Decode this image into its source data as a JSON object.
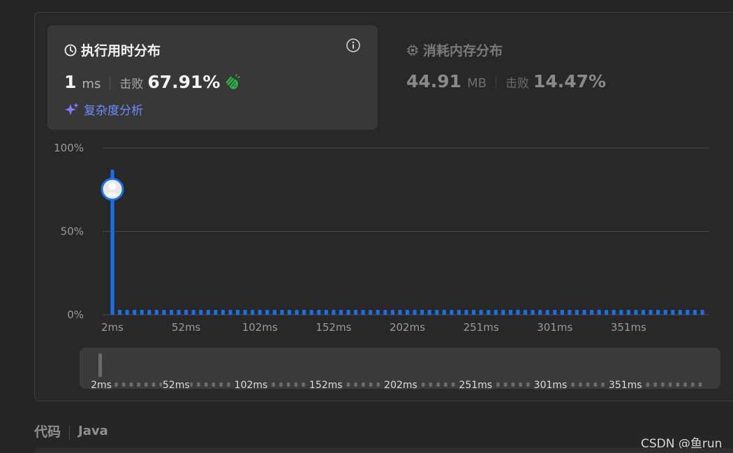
{
  "runtime_card": {
    "title": "执行用时分布",
    "value": "1",
    "unit": "ms",
    "beats_label": "击败",
    "beats_value": "67.91%",
    "complexity_link": "复杂度分析"
  },
  "memory_card": {
    "title": "消耗内存分布",
    "value": "44.91",
    "unit": "MB",
    "beats_label": "击败",
    "beats_value": "14.47%"
  },
  "chart_data": {
    "type": "bar",
    "title": "",
    "xlabel": "",
    "ylabel": "",
    "ylim": [
      0,
      100
    ],
    "y_ticks": [
      "0%",
      "50%",
      "100%"
    ],
    "x_tick_labels": [
      "2ms",
      "52ms",
      "102ms",
      "152ms",
      "202ms",
      "251ms",
      "301ms",
      "351ms"
    ],
    "highlight_bar": {
      "x": "2ms",
      "value": 87
    },
    "series": [
      {
        "values": [
          87,
          3,
          3,
          3,
          3,
          3,
          3,
          3,
          3,
          3,
          3,
          3,
          3,
          3,
          3,
          3,
          3,
          3,
          3,
          3,
          3,
          3,
          3,
          3,
          3,
          3,
          3,
          3,
          3,
          3,
          3,
          3,
          3,
          3,
          3,
          3,
          3,
          3,
          3,
          3,
          3,
          3,
          3,
          3,
          3,
          3,
          3,
          3,
          3,
          3,
          3,
          3,
          3,
          3,
          3,
          3,
          3,
          3,
          3,
          3,
          3,
          3,
          3,
          3,
          3,
          3,
          3,
          3,
          3,
          3,
          3,
          3,
          3,
          3,
          3,
          3,
          3,
          3,
          3,
          3,
          3
        ]
      }
    ],
    "colors": {
      "bar": "#1a6fe8",
      "grid": "#4a4a4a",
      "tick": "#9a9a9a"
    }
  },
  "range_selector": {
    "tick_labels": [
      "2ms",
      "52ms",
      "102ms",
      "152ms",
      "202ms",
      "251ms",
      "301ms",
      "351ms"
    ]
  },
  "code_section": {
    "label": "代码",
    "language": "Java"
  },
  "watermark": "CSDN @鱼run"
}
